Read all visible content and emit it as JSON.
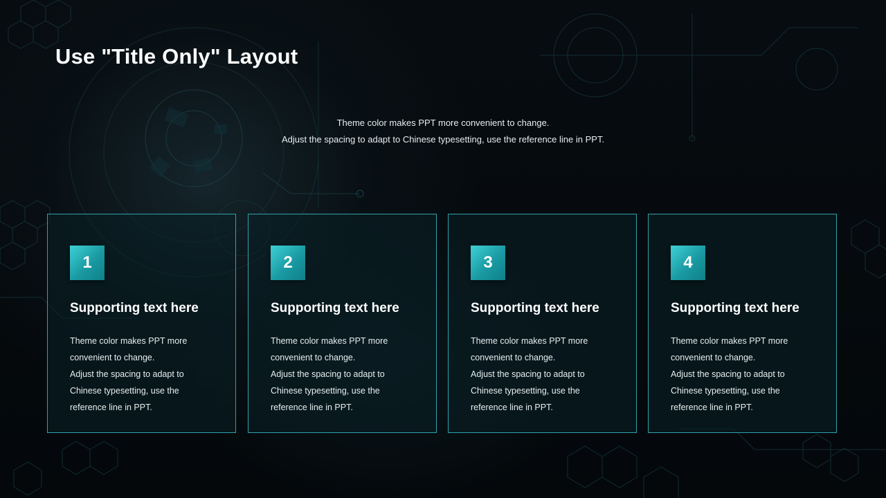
{
  "slide": {
    "title": "Use \"Title Only\" Layout",
    "subtitle_lines": [
      "Theme color makes PPT more convenient  to change.",
      "Adjust the spacing to adapt to Chinese  typesetting, use the reference line  in PPT."
    ]
  },
  "cards": [
    {
      "number": "1",
      "title": "Supporting text here",
      "body_lines": [
        "Theme  color makes PPT more",
        "convenient  to change.",
        "Adjust the spacing to adapt to",
        "Chinese  typesetting, use the",
        "reference line in PPT."
      ]
    },
    {
      "number": "2",
      "title": "Supporting text here",
      "body_lines": [
        "Theme  color makes PPT more",
        "convenient  to change.",
        "Adjust the spacing to adapt to",
        "Chinese  typesetting, use the",
        "reference line in PPT."
      ]
    },
    {
      "number": "3",
      "title": "Supporting text here",
      "body_lines": [
        "Theme  color makes PPT more",
        "convenient  to change.",
        "Adjust the spacing to adapt to",
        "Chinese  typesetting, use the",
        "reference line in PPT."
      ]
    },
    {
      "number": "4",
      "title": "Supporting text here",
      "body_lines": [
        "Theme  color makes PPT more",
        "convenient  to change.",
        "Adjust the spacing to adapt to",
        "Chinese  typesetting, use the",
        "reference line in PPT."
      ]
    }
  ],
  "colors": {
    "background": "#05090c",
    "accent": "#1fb3bc",
    "card_border": "#2fa3ad",
    "text": "#ffffff"
  }
}
